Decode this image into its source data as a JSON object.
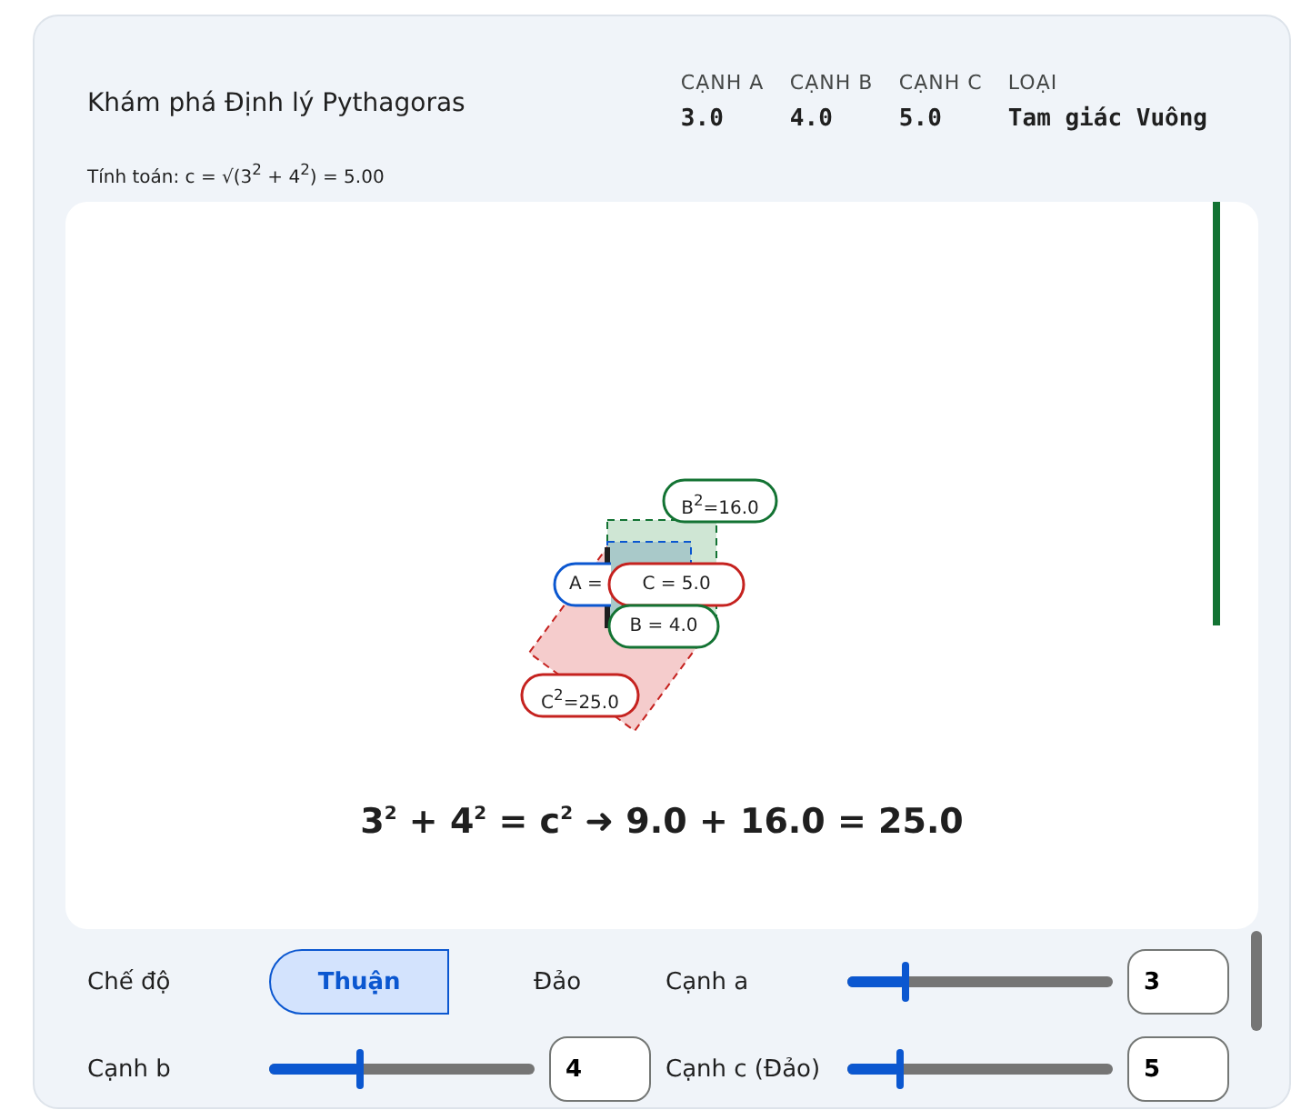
{
  "header": {
    "title": "Khám phá Định lý Pythagoras",
    "calculation": "Tính toán: c = √(3$^{2}$ + 4$^{2}$) = 5.00"
  },
  "stats": [
    {
      "label": "CẠNH A",
      "value": "3.0"
    },
    {
      "label": "CẠNH B",
      "value": "4.0"
    },
    {
      "label": "CẠNH C",
      "value": "5.0"
    },
    {
      "label": "LOẠI",
      "value": "Tam giác Vuông"
    }
  ],
  "diagram": {
    "labels": [
      {
        "kind": "b2",
        "text": "B$^{2}$=16.0"
      },
      {
        "kind": "a",
        "text": "A ="
      },
      {
        "kind": "c",
        "text": "C = 5.0"
      },
      {
        "kind": "b",
        "text": "B = 4.0"
      },
      {
        "kind": "c2",
        "text": "C$^{2}$=25.0"
      }
    ],
    "equation": "3$^{2}$ + 4$^{2}$ = c$^{2}$  ➜  9.0 + 16.0 = 25.0"
  },
  "controls": {
    "mode": {
      "label": "Chế độ",
      "options": [
        {
          "label": "Thuận",
          "selected": true
        },
        {
          "label": "Đảo",
          "selected": false
        }
      ]
    },
    "sliders": [
      {
        "label": "Cạnh a",
        "level": 0.22,
        "value": "3"
      },
      {
        "label": "Cạnh b",
        "level": 0.34,
        "value": "4"
      },
      {
        "label": "Cạnh c (Đảo)",
        "level": 0.2,
        "value": "5"
      }
    ]
  }
}
